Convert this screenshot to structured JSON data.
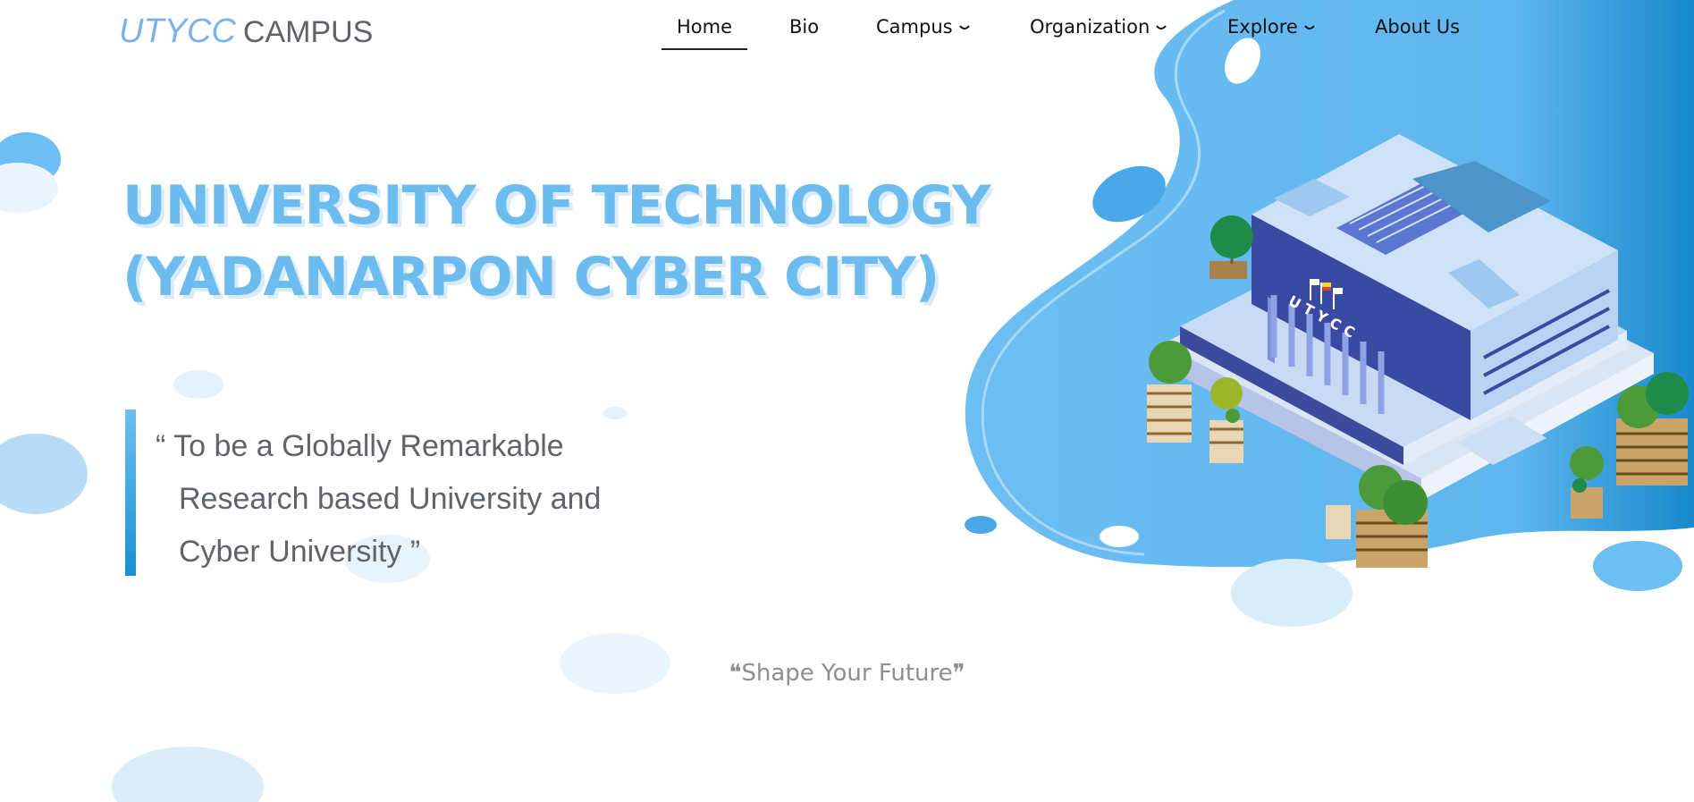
{
  "logo": {
    "main": "UTYCC",
    "sub": "CAMPUS"
  },
  "nav": {
    "items": [
      {
        "label": "Home",
        "active": true
      },
      {
        "label": "Bio"
      },
      {
        "label": "Campus",
        "dropdown": true
      },
      {
        "label": "Organization",
        "dropdown": true
      },
      {
        "label": "Explore",
        "dropdown": true
      },
      {
        "label": "About Us"
      }
    ]
  },
  "hero": {
    "title_line1": "UNIVERSITY OF TECHNOLOGY",
    "title_line2": "(YADANARPON CYBER CITY)",
    "quote_line1": "“ To be a Globally Remarkable",
    "quote_line2": "Research based University and",
    "quote_line3": "Cyber University ”",
    "illustration_label": "U T Y C C",
    "tagline": "❝Shape Your Future❞"
  },
  "colors": {
    "accent": "#6cbcf0",
    "accent_dark": "#1a8fd0",
    "text_gray": "#606468",
    "building_navy": "#2e3b8f",
    "tree_green": "#2e8b3e"
  }
}
